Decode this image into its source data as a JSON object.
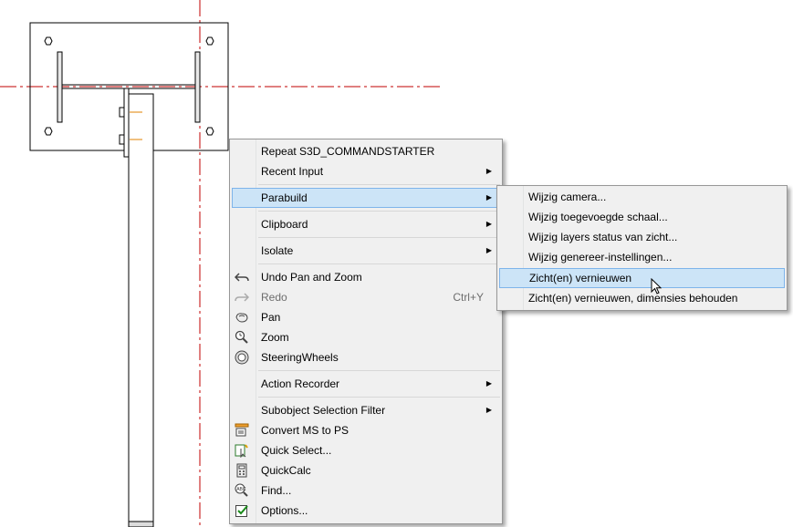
{
  "context_menu": {
    "items": [
      {
        "label": "Repeat S3D_COMMANDSTARTER"
      },
      {
        "label": "Recent Input"
      },
      {
        "label": "Parabuild"
      },
      {
        "label": "Clipboard"
      },
      {
        "label": "Isolate"
      },
      {
        "label": "Undo Pan and Zoom",
        "icon": "undo-icon"
      },
      {
        "label": "Redo",
        "shortcut": "Ctrl+Y",
        "icon": "redo-icon"
      },
      {
        "label": "Pan",
        "icon": "pan-hand-icon"
      },
      {
        "label": "Zoom",
        "icon": "zoom-icon"
      },
      {
        "label": "SteeringWheels",
        "icon": "steering-wheel-icon"
      },
      {
        "label": "Action Recorder"
      },
      {
        "label": "Subobject Selection Filter"
      },
      {
        "label": "Convert MS to PS",
        "icon": "convert-icon"
      },
      {
        "label": "Quick Select...",
        "icon": "quick-select-icon"
      },
      {
        "label": "QuickCalc",
        "icon": "calculator-icon"
      },
      {
        "label": "Find...",
        "icon": "find-text-icon"
      },
      {
        "label": "Options...",
        "icon": "options-check-icon"
      }
    ]
  },
  "submenu": {
    "items": [
      {
        "label": "Wijzig camera..."
      },
      {
        "label": "Wijzig toegevoegde schaal..."
      },
      {
        "label": "Wijzig layers status van zicht..."
      },
      {
        "label": "Wijzig genereer-instellingen..."
      },
      {
        "label": "Zicht(en) vernieuwen"
      },
      {
        "label": "Zicht(en) vernieuwen, dimensies behouden"
      }
    ]
  },
  "colors": {
    "highlight_bg": "#cce4f7",
    "highlight_border": "#7eb4ea",
    "menu_bg": "#f0f0f0",
    "centerline": "#c00000",
    "drawing_line": "#000000"
  }
}
